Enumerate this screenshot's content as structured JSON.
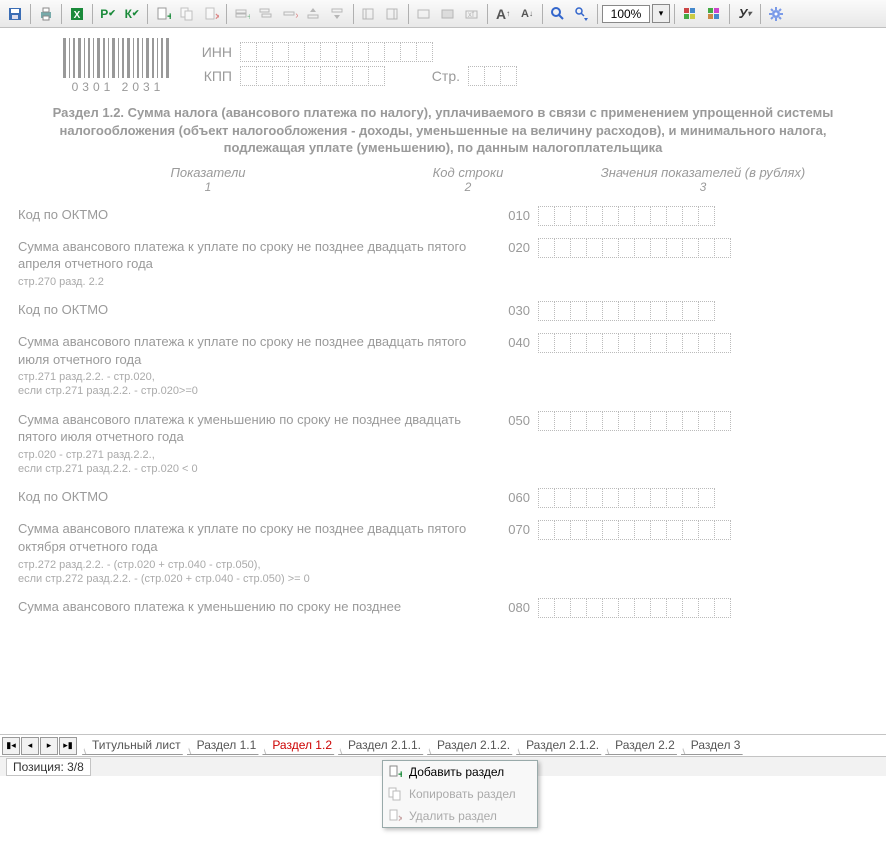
{
  "toolbar": {
    "zoom": "100%"
  },
  "header": {
    "barcode_number": "0301 2031",
    "inn_label": "ИНН",
    "kpp_label": "КПП",
    "page_label": "Стр."
  },
  "section_title": "Раздел 1.2. Сумма налога (авансового платежа по налогу), уплачиваемого в связи с применением упрощенной системы налогообложения (объект налогообложения - доходы, уменьшенные на величину расходов), и минимального налога, подлежащая уплате (уменьшению), по данным налогоплательщика",
  "columns": {
    "c1": "Показатели",
    "n1": "1",
    "c2": "Код строки",
    "n2": "2",
    "c3": "Значения показателей (в рублях)",
    "n3": "3"
  },
  "rows": [
    {
      "label": "Код по ОКТМО",
      "code": "010",
      "note": ""
    },
    {
      "label": "Сумма авансового платежа к уплате по сроку не позднее двадцать пятого апреля отчетного года",
      "code": "020",
      "note": "стр.270 разд. 2.2"
    },
    {
      "label": "Код по ОКТМО",
      "code": "030",
      "note": ""
    },
    {
      "label": "Сумма  авансового платежа к уплате по сроку не позднее двадцать пятого июля отчетного года",
      "code": "040",
      "note": "стр.271 разд.2.2. - стр.020,\nесли стр.271 разд.2.2. - стр.020>=0"
    },
    {
      "label": "Сумма авансового платежа к уменьшению по сроку не позднее двадцать пятого июля отчетного года",
      "code": "050",
      "note": "стр.020 - стр.271 разд.2.2.,\nесли стр.271 разд.2.2. - стр.020 < 0"
    },
    {
      "label": "Код по ОКТМО",
      "code": "060",
      "note": ""
    },
    {
      "label": "Сумма авансового платежа к уплате по сроку не позднее двадцать пятого октября отчетного года",
      "code": "070",
      "note": "стр.272 разд.2.2. - (стр.020 + стр.040 - стр.050),\nесли стр.272 разд.2.2. - (стр.020 + стр.040 - стр.050) >= 0"
    },
    {
      "label": "Сумма авансового платежа к уменьшению по сроку не позднее",
      "code": "080",
      "note": ""
    }
  ],
  "tabs": [
    "Титульный лист",
    "Раздел 1.1",
    "Раздел 1.2",
    "Раздел 2.1.1.",
    "Раздел 2.1.2.",
    "Раздел 2.1.2.",
    "Раздел 2.2",
    "Раздел 3"
  ],
  "active_tab_index": 2,
  "status": {
    "position_label": "Позиция: 3/8"
  },
  "context_menu": {
    "add": "Добавить раздел",
    "copy": "Копировать раздел",
    "del": "Удалить раздел"
  }
}
